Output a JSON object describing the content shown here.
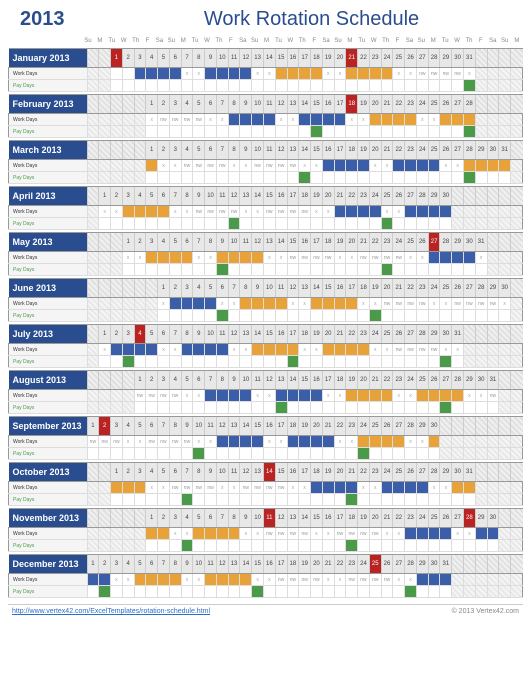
{
  "year": "2013",
  "title": "Work Rotation Schedule",
  "dow": [
    "Su",
    "M",
    "Tu",
    "W",
    "Th",
    "F",
    "Sa",
    "Su",
    "M",
    "Tu",
    "W",
    "Th",
    "F",
    "Sa",
    "Su",
    "M",
    "Tu",
    "W",
    "Th",
    "F",
    "Sa",
    "Su",
    "M",
    "Tu",
    "W",
    "Th",
    "F",
    "Sa",
    "Su",
    "M",
    "Tu",
    "W",
    "Th",
    "F",
    "Sa",
    "Su",
    "M"
  ],
  "row_labels": {
    "work": "Work Days",
    "pay": "Pay Days"
  },
  "footer_link": "http://www.vertex42.com/ExcelTemplates/rotation-schedule.html",
  "footer_copy": "© 2013 Vertex42.com",
  "months": [
    {
      "name": "January 2013",
      "start": 2,
      "len": 31,
      "hol": [
        1,
        21
      ],
      "work": [
        null,
        null,
        "b",
        "b",
        "b",
        "b",
        "x",
        "x",
        "b",
        "b",
        "b",
        "b",
        "x",
        "x",
        "o",
        "o",
        "o",
        "o",
        "x",
        "x",
        "o",
        "o",
        "o",
        "o",
        "x",
        "x",
        "nw",
        "nw",
        "nw",
        "nw",
        "x"
      ],
      "pay": [
        null,
        null,
        null,
        null,
        null,
        null,
        null,
        null,
        null,
        null,
        null,
        null,
        null,
        null,
        null,
        null,
        null,
        null,
        null,
        null,
        null,
        null,
        null,
        null,
        null,
        null,
        null,
        null,
        null,
        null,
        "g"
      ]
    },
    {
      "name": "February 2013",
      "start": 5,
      "len": 28,
      "hol": [
        18
      ],
      "work": [
        "x",
        "nw",
        "nw",
        "nw",
        "nw",
        "x",
        "x",
        "b",
        "b",
        "b",
        "b",
        "x",
        "x",
        "b",
        "b",
        "b",
        "b",
        "x",
        "x",
        "o",
        "o",
        "o",
        "o",
        "x",
        "x",
        "o",
        "o",
        "o"
      ],
      "pay": [
        null,
        null,
        null,
        null,
        null,
        null,
        null,
        null,
        null,
        null,
        null,
        null,
        null,
        null,
        "g",
        null,
        null,
        null,
        null,
        null,
        null,
        null,
        null,
        null,
        null,
        null,
        null,
        "g"
      ]
    },
    {
      "name": "March 2013",
      "start": 5,
      "len": 31,
      "hol": [],
      "work": [
        "o",
        "x",
        "x",
        "nw",
        "nw",
        "nw",
        "nw",
        "x",
        "x",
        "nw",
        "nw",
        "nw",
        "nw",
        "x",
        "x",
        "b",
        "b",
        "b",
        "b",
        "x",
        "x",
        "b",
        "b",
        "b",
        "b",
        "x",
        "x",
        "o",
        "o",
        "o",
        "o"
      ],
      "pay": [
        null,
        null,
        null,
        null,
        null,
        null,
        null,
        null,
        null,
        null,
        null,
        null,
        null,
        "g",
        null,
        null,
        null,
        null,
        null,
        null,
        null,
        null,
        null,
        null,
        null,
        null,
        null,
        "g",
        null,
        null,
        null
      ]
    },
    {
      "name": "April 2013",
      "start": 1,
      "len": 30,
      "hol": [],
      "work": [
        "x",
        "x",
        "o",
        "o",
        "o",
        "o",
        "x",
        "x",
        "nw",
        "nw",
        "nw",
        "nw",
        "x",
        "x",
        "nw",
        "nw",
        "nw",
        "nw",
        "x",
        "x",
        "b",
        "b",
        "b",
        "b",
        "x",
        "x",
        "b",
        "b",
        "b",
        "b"
      ],
      "pay": [
        null,
        null,
        null,
        null,
        null,
        null,
        null,
        null,
        null,
        null,
        null,
        "g",
        null,
        null,
        null,
        null,
        null,
        null,
        null,
        null,
        null,
        null,
        null,
        null,
        "g",
        null,
        null,
        null,
        null,
        null
      ]
    },
    {
      "name": "May 2013",
      "start": 3,
      "len": 31,
      "hol": [
        27
      ],
      "work": [
        "x",
        "x",
        "o",
        "o",
        "o",
        "o",
        "x",
        "x",
        "o",
        "o",
        "o",
        "o",
        "x",
        "x",
        "nw",
        "nw",
        "nw",
        "nw",
        "x",
        "x",
        "nw",
        "nw",
        "nw",
        "nw",
        "x",
        "x",
        "b",
        "b",
        "b",
        "b",
        "x"
      ],
      "pay": [
        null,
        null,
        null,
        null,
        null,
        null,
        null,
        null,
        "g",
        null,
        null,
        null,
        null,
        null,
        null,
        null,
        null,
        null,
        null,
        null,
        null,
        null,
        "g",
        null,
        null,
        null,
        null,
        null,
        null,
        null,
        null
      ]
    },
    {
      "name": "June 2013",
      "start": 6,
      "len": 30,
      "hol": [],
      "work": [
        "x",
        "b",
        "b",
        "b",
        "b",
        "x",
        "x",
        "o",
        "o",
        "o",
        "o",
        "x",
        "x",
        "o",
        "o",
        "o",
        "o",
        "x",
        "x",
        "nw",
        "nw",
        "nw",
        "nw",
        "x",
        "x",
        "nw",
        "nw",
        "nw",
        "nw",
        "x"
      ],
      "pay": [
        null,
        null,
        null,
        null,
        null,
        "g",
        null,
        null,
        null,
        null,
        null,
        null,
        null,
        null,
        null,
        null,
        null,
        null,
        "g",
        null,
        null,
        null,
        null,
        null,
        null,
        null,
        null,
        null,
        null,
        null
      ]
    },
    {
      "name": "July 2013",
      "start": 1,
      "len": 31,
      "hol": [
        4
      ],
      "work": [
        "x",
        "b",
        "b",
        "b",
        "b",
        "x",
        "x",
        "b",
        "b",
        "b",
        "b",
        "x",
        "x",
        "o",
        "o",
        "o",
        "o",
        "x",
        "x",
        "o",
        "o",
        "o",
        "o",
        "x",
        "x",
        "nw",
        "nw",
        "nw",
        "nw",
        "x",
        "x"
      ],
      "pay": [
        null,
        null,
        "g",
        null,
        null,
        null,
        null,
        null,
        null,
        null,
        null,
        null,
        null,
        null,
        null,
        null,
        "g",
        null,
        null,
        null,
        null,
        null,
        null,
        null,
        null,
        null,
        null,
        null,
        null,
        "g",
        null
      ]
    },
    {
      "name": "August 2013",
      "start": 4,
      "len": 31,
      "hol": [],
      "work": [
        "nw",
        "nw",
        "nw",
        "nw",
        "x",
        "x",
        "b",
        "b",
        "b",
        "b",
        "x",
        "x",
        "b",
        "b",
        "b",
        "b",
        "x",
        "x",
        "o",
        "o",
        "o",
        "o",
        "x",
        "x",
        "o",
        "o",
        "o",
        "o",
        "x",
        "x",
        "nw"
      ],
      "pay": [
        null,
        null,
        null,
        null,
        null,
        null,
        null,
        null,
        null,
        null,
        null,
        null,
        "g",
        null,
        null,
        null,
        null,
        null,
        null,
        null,
        null,
        null,
        null,
        null,
        null,
        null,
        "g",
        null,
        null,
        null,
        null
      ]
    },
    {
      "name": "September 2013",
      "start": 0,
      "len": 30,
      "hol": [
        2
      ],
      "work": [
        "nw",
        "nw",
        "nw",
        "x",
        "x",
        "nw",
        "nw",
        "nw",
        "nw",
        "x",
        "x",
        "b",
        "b",
        "b",
        "b",
        "x",
        "x",
        "b",
        "b",
        "b",
        "b",
        "x",
        "x",
        "o",
        "o",
        "o",
        "o",
        "x",
        "x",
        "o"
      ],
      "pay": [
        null,
        null,
        null,
        null,
        null,
        null,
        null,
        null,
        null,
        "g",
        null,
        null,
        null,
        null,
        null,
        null,
        null,
        null,
        null,
        null,
        null,
        null,
        null,
        "g",
        null,
        null,
        null,
        null,
        null,
        null
      ]
    },
    {
      "name": "October 2013",
      "start": 2,
      "len": 31,
      "hol": [
        14
      ],
      "work": [
        "o",
        "o",
        "o",
        "x",
        "x",
        "nw",
        "nw",
        "nw",
        "nw",
        "x",
        "x",
        "nw",
        "nw",
        "nw",
        "nw",
        "x",
        "x",
        "b",
        "b",
        "b",
        "b",
        "x",
        "x",
        "b",
        "b",
        "b",
        "b",
        "x",
        "x",
        "o",
        "o"
      ],
      "pay": [
        null,
        null,
        null,
        null,
        null,
        null,
        "g",
        null,
        null,
        null,
        null,
        null,
        null,
        null,
        null,
        null,
        null,
        null,
        null,
        null,
        "g",
        null,
        null,
        null,
        null,
        null,
        null,
        null,
        null,
        null,
        null
      ]
    },
    {
      "name": "November 2013",
      "start": 5,
      "len": 30,
      "hol": [
        11,
        28
      ],
      "work": [
        "o",
        "o",
        "x",
        "x",
        "o",
        "o",
        "o",
        "o",
        "x",
        "x",
        "nw",
        "nw",
        "nw",
        "nw",
        "x",
        "x",
        "nw",
        "nw",
        "nw",
        "nw",
        "x",
        "x",
        "b",
        "b",
        "b",
        "b",
        "x",
        "x",
        "b",
        "b"
      ],
      "pay": [
        null,
        null,
        null,
        "g",
        null,
        null,
        null,
        null,
        null,
        null,
        null,
        null,
        null,
        null,
        null,
        null,
        null,
        "g",
        null,
        null,
        null,
        null,
        null,
        null,
        null,
        null,
        null,
        null,
        null,
        null
      ]
    },
    {
      "name": "December 2013",
      "start": 0,
      "len": 31,
      "hol": [
        25
      ],
      "work": [
        "b",
        "b",
        "x",
        "x",
        "o",
        "o",
        "o",
        "o",
        "x",
        "x",
        "o",
        "o",
        "o",
        "o",
        "x",
        "x",
        "nw",
        "nw",
        "nw",
        "nw",
        "x",
        "x",
        "nw",
        "nw",
        "nw",
        "nw",
        "x",
        "x",
        "b",
        "b",
        "b"
      ],
      "pay": [
        null,
        "g",
        null,
        null,
        null,
        null,
        null,
        null,
        null,
        null,
        null,
        null,
        null,
        null,
        "g",
        null,
        null,
        null,
        null,
        null,
        null,
        null,
        null,
        null,
        null,
        null,
        null,
        "g",
        null,
        null,
        null
      ]
    }
  ]
}
